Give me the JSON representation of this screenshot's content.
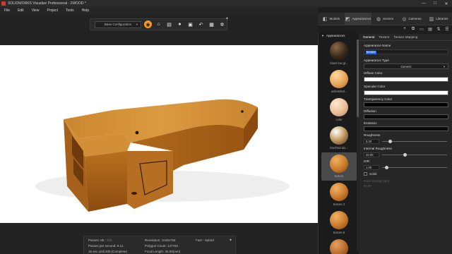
{
  "window": {
    "title": "SOLIDWORKS Visualize Professional - 2WOOD *",
    "controls": [
      "—",
      "□",
      "✕"
    ]
  },
  "menu": [
    "File",
    "Edit",
    "View",
    "Project",
    "Tools",
    "Help"
  ],
  "toolbar": {
    "configuration": "Base Configuration",
    "tools": [
      {
        "icon": "render-mode-icon",
        "glyph": "◉",
        "active": true
      },
      {
        "icon": "camera-icon",
        "glyph": "⌂",
        "active": false
      },
      {
        "icon": "printer-icon",
        "glyph": "▤",
        "active": false
      },
      {
        "icon": "teapot-icon",
        "glyph": "♠",
        "active": false
      },
      {
        "icon": "render-output-icon",
        "glyph": "▣",
        "active": false
      },
      {
        "icon": "undo-icon",
        "glyph": "↶",
        "active": false
      },
      {
        "icon": "grid-icon",
        "glyph": "▦",
        "active": false
      },
      {
        "icon": "settings-wheel-icon",
        "glyph": "✲",
        "active": false
      }
    ]
  },
  "status": {
    "passes_label": "Passes: 86",
    "passes_total": "/ 200",
    "pps": "Passes per second: 9.12",
    "time": "16 sec until 200 (Complete)",
    "resolution": "Resolution: 1048x758",
    "polygons": "Polygon Count: 147760",
    "focal": "Focal Length: 35.00(mm)",
    "mode": "Fast - Hybrid"
  },
  "panel_tabs": [
    {
      "label": "Models",
      "icon": "cube-icon",
      "glyph": "◧"
    },
    {
      "label": "Appearances",
      "icon": "appearances-icon",
      "glyph": "◩",
      "active": true
    },
    {
      "label": "Scenes",
      "icon": "scenes-icon",
      "glyph": "◍"
    },
    {
      "label": "Cameras",
      "icon": "cameras-icon",
      "glyph": "◎"
    },
    {
      "label": "Libraries",
      "icon": "libraries-icon",
      "glyph": "▥"
    }
  ],
  "panel_icons": [
    {
      "name": "add-icon",
      "glyph": "+"
    },
    {
      "name": "duplicate-icon",
      "glyph": "⧉"
    },
    {
      "name": "folder-icon",
      "glyph": "▭"
    },
    {
      "name": "layers-icon",
      "glyph": "▤"
    },
    {
      "name": "sort-icon",
      "glyph": "⇅"
    },
    {
      "name": "list-view-icon",
      "glyph": "☰"
    }
  ],
  "appearances": {
    "header": "Appearances",
    "items": [
      {
        "label": "black low gl...",
        "color": "radial-gradient(circle at 35% 30%, #8a6a48, #3a2a1c 55%, #1a120c)"
      },
      {
        "label": "unfinished...",
        "color": "radial-gradient(circle at 35% 30%, #ffd9a0, #e3a458 55%, #a5692a)"
      },
      {
        "label": "color",
        "color": "radial-gradient(circle at 35% 30%, #ffe8d0, #e8bd96 55%, #b48460)"
      },
      {
        "label": "brushed alu...",
        "color": "radial-gradient(circle at 35% 30%, #ffffff, #c9a26a 45%, #4a3418)"
      },
      {
        "label": "texture",
        "color": "radial-gradient(circle at 35% 30%, #f0b060, #c97b2a 55%, #7a4510)",
        "selected": true
      },
      {
        "label": "texture 3",
        "color": "radial-gradient(circle at 35% 30%, #f3b468, #c8782a 55%, #7e4612)"
      },
      {
        "label": "texture 6",
        "color": "radial-gradient(circle at 35% 30%, #f3b468, #c8782a 55%, #7e4612)"
      },
      {
        "label": "texture 10",
        "color": "radial-gradient(circle at 35% 30%, #e7a260, #b46a2c 55%, #6e3d14)"
      }
    ]
  },
  "properties": {
    "subtabs": [
      "General",
      "Texture",
      "Texture Mapping"
    ],
    "name_label": "Appearance Name",
    "name_value": "texture",
    "type_label": "Appearance Type",
    "type_value": "Generic",
    "diffuse_label": "Diffuse Color",
    "diffuse_color": "#ffffff",
    "specular_label": "Specular Color",
    "specular_color": "#ffffff",
    "transparency_label": "Transparency Color",
    "transparency_color": "#000000",
    "diffusion_label": "Diffusion",
    "diffusion_color": "#0a0a0a",
    "emission_label": "Emission",
    "emission_color": "#0a0a0a",
    "roughness_label": "Roughness",
    "roughness_value": "0.20",
    "roughness_frac": 0.12,
    "internal_label": "Internal Roughness",
    "internal_value": "20.00",
    "internal_frac": 0.35,
    "ior_label": "IOR",
    "ior_value": "1.00",
    "ior_frac": 0.06,
    "solid_label": "Solid",
    "color_density_label": "Color Density (mm)",
    "color_density_value": "50.00"
  }
}
